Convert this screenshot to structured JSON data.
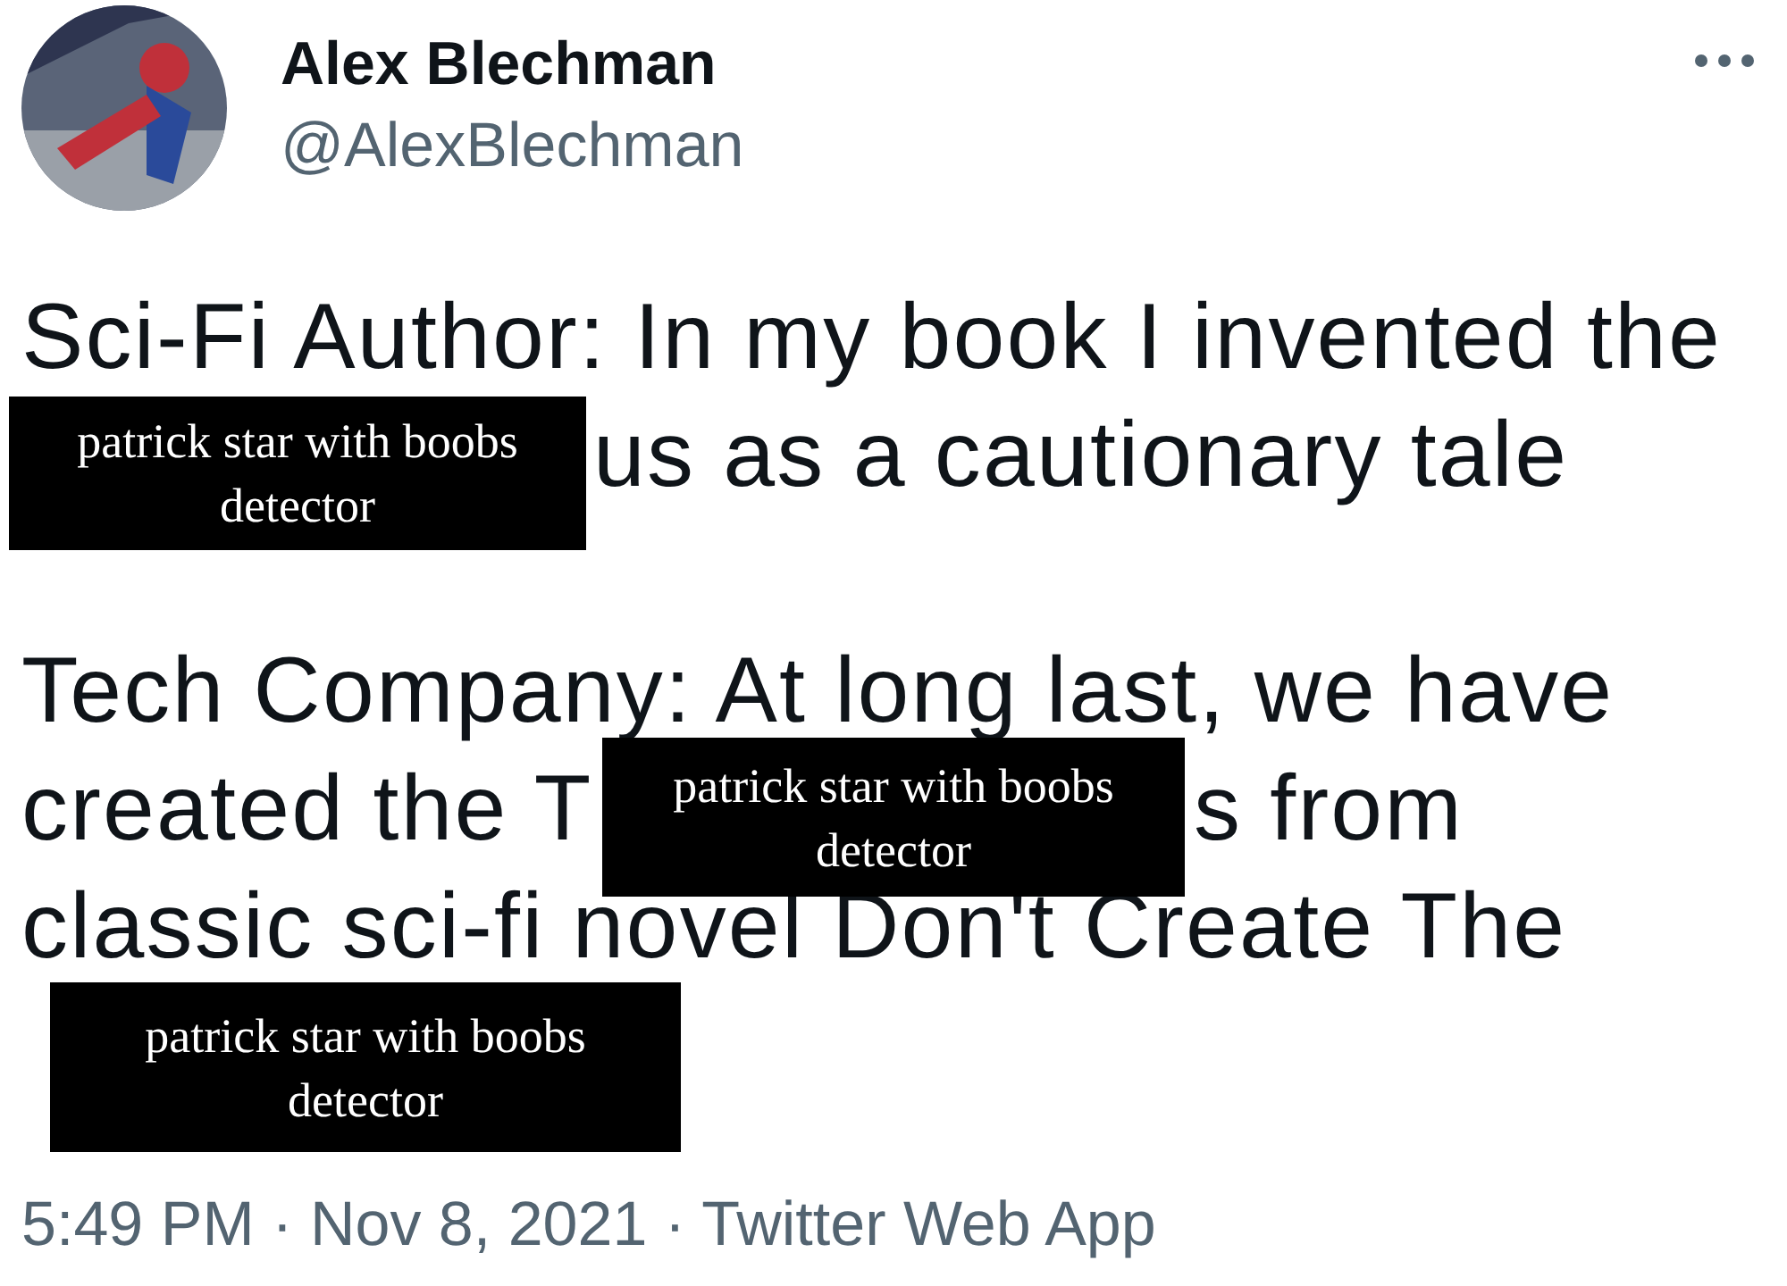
{
  "author": {
    "name": "Alex Blechman",
    "handle": "@AlexBlechman"
  },
  "paragraphs": [
    {
      "lines": [
        [
          "Sci-Fi Author: In my book I invented the"
        ],
        [
          "us as a cautionary tale"
        ]
      ]
    },
    {
      "lines": [
        [
          "Tech Company: At long last, we have"
        ],
        [
          "created the T",
          "s from"
        ],
        [
          "classic sci-fi novel Don't Create The"
        ]
      ]
    }
  ],
  "captions": [
    "patrick star with boobs detector",
    "patrick star with boobs detector",
    "patrick star with boobs detector"
  ],
  "timestamp": "5:49 PM · Nov 8, 2021 · Twitter Web App"
}
